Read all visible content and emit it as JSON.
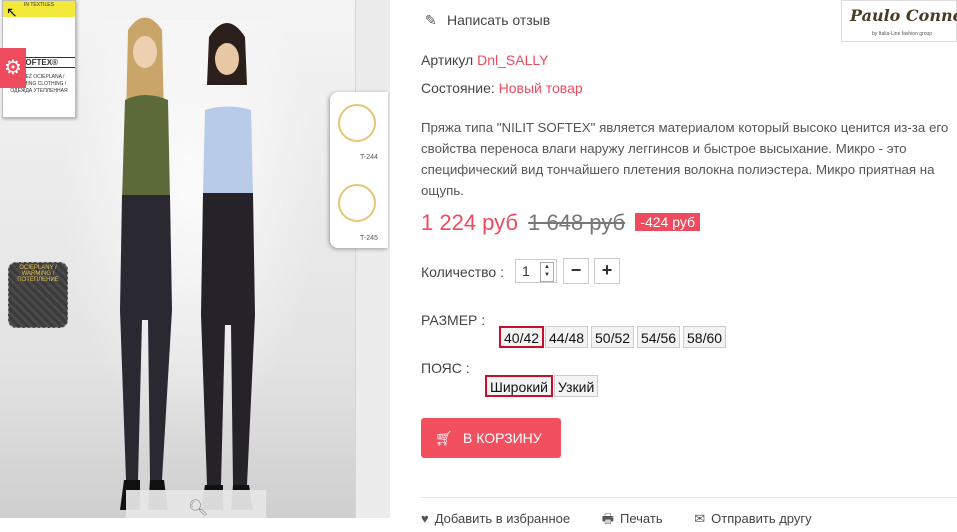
{
  "gallery": {
    "label_card": {
      "top_text": "IN TEXTILES",
      "brand_text": "SOFTEX®",
      "warm_text": "ODZIEŻ OCIEPLANA / WARMING CLOTHING / ОДЕЖДА УТЕПЛЕННАЯ"
    },
    "side_tag": {
      "code1": "T-244",
      "code2": "T-245"
    },
    "fabric_text": "OCIEPLANY / WARMING / ПОТЕПЛЕНИЕ"
  },
  "brand": {
    "name": "Paulo Conner",
    "sub": "by Italia-Line fashion group"
  },
  "review_link": "Написать отзыв",
  "article": {
    "label": "Артикул",
    "value": "Dnl_SALLY"
  },
  "condition": {
    "label": "Состояние:",
    "value": "Новый товар"
  },
  "description": "Пряжа типа \"NILIT SOFTEX\" является материалом который высоко ценится из-за его свойства переноса влаги наружу леггинсов и быстрое высыхание. Микро - это специфический вид тончайшего плетения волокна полиэстера. Микро приятная на ощупь.",
  "price": {
    "current": "1 224 руб",
    "old": "1 648 руб",
    "discount": "-424 руб"
  },
  "quantity": {
    "label": "Количество :",
    "value": "1",
    "minus": "−",
    "plus": "+"
  },
  "size": {
    "label": "РАЗМЕР :",
    "options": [
      "40/42",
      "44/48",
      "50/52",
      "54/56",
      "58/60"
    ],
    "selected": "40/42"
  },
  "belt": {
    "label": "ПОЯС :",
    "options": [
      "Широкий",
      "Узкий"
    ],
    "selected": "Широкий"
  },
  "cart_button": "В КОРЗИНУ",
  "footer": {
    "favorites": "Добавить в избранное",
    "print": "Печать",
    "send": "Отправить другу"
  },
  "colors": {
    "accent": "#ee4b5f",
    "selected_border": "#c8102e"
  }
}
